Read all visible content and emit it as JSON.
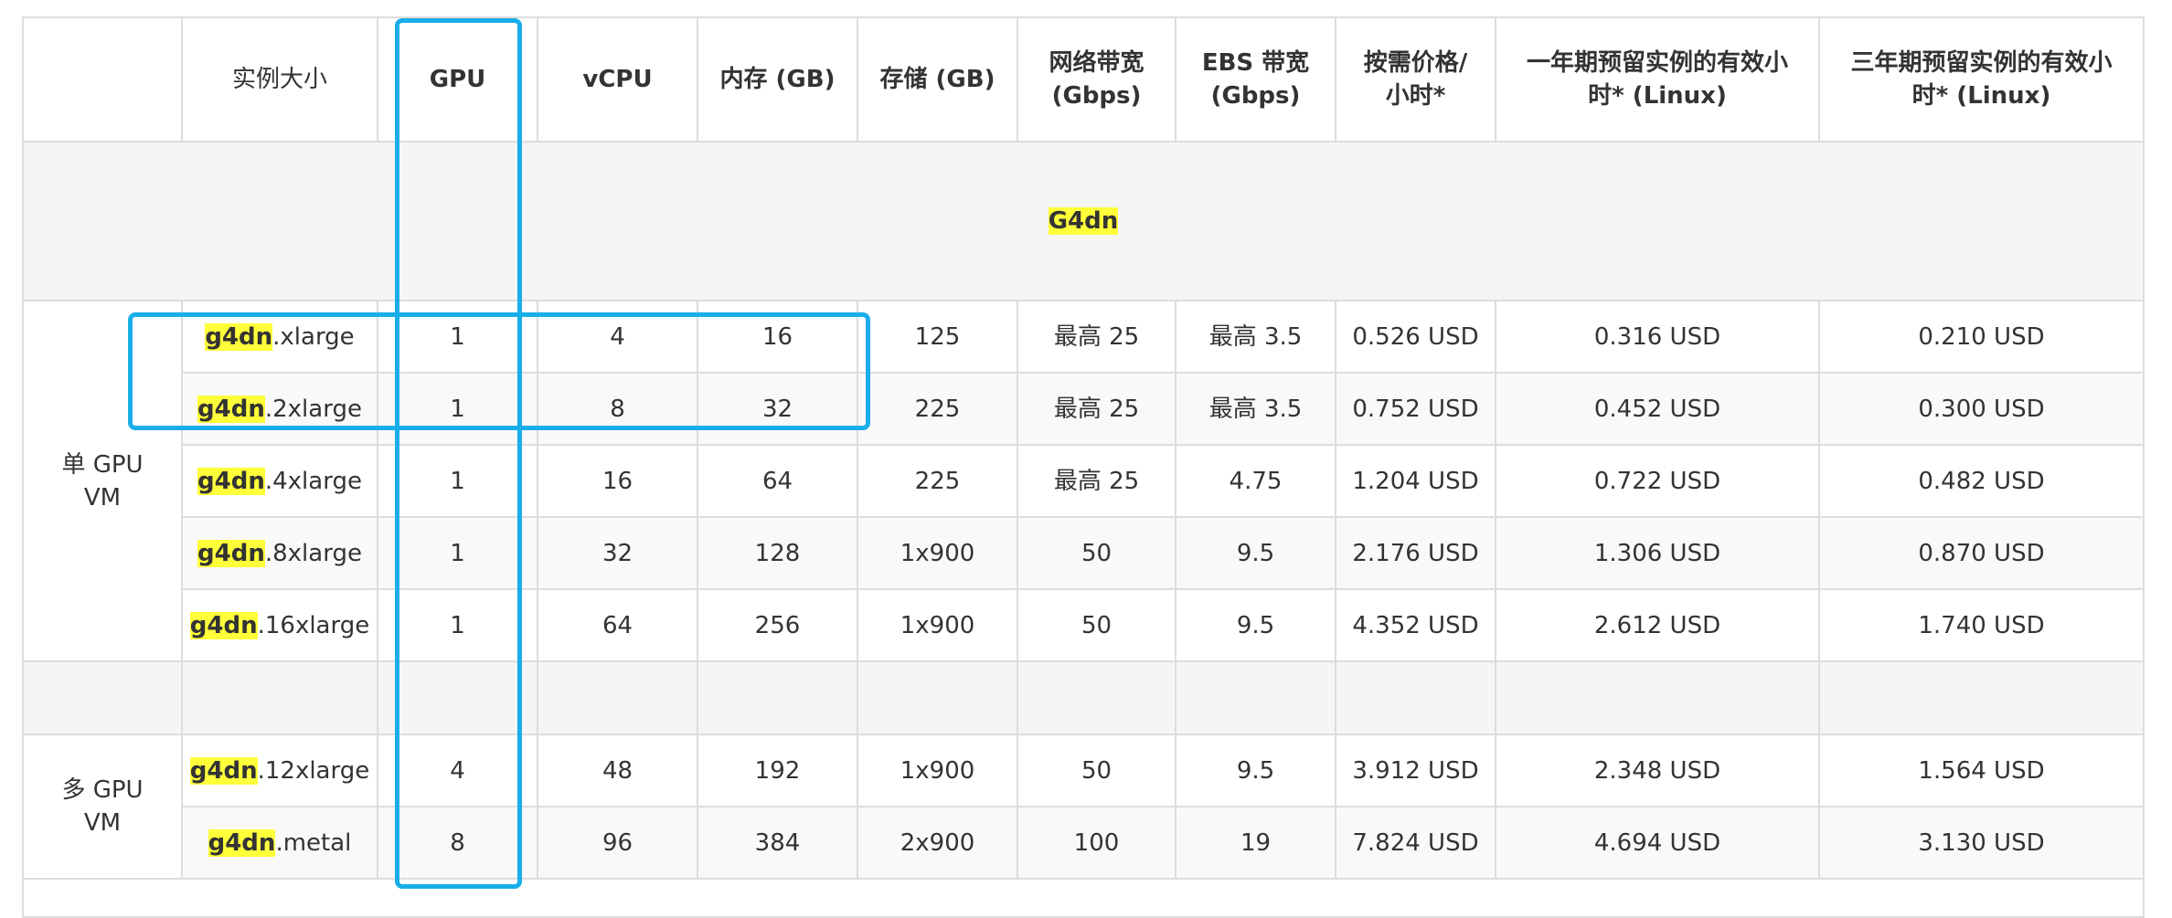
{
  "headers": {
    "group": "",
    "size": "实例大小",
    "gpu": "GPU",
    "vcpu": "vCPU",
    "memory": "内存 (GB)",
    "storage": "存储 (GB)",
    "network_l1": "网络带宽",
    "network_l2": "(Gbps)",
    "ebs_l1": "EBS 带宽",
    "ebs_l2": "(Gbps)",
    "ondemand_l1": "按需价格/",
    "ondemand_l2": "小时*",
    "ri1_l1": "一年期预留实例的有效小",
    "ri1_l2": "时* (Linux)",
    "ri3_l1": "三年期预留实例的有效小",
    "ri3_l2": "时* (Linux)"
  },
  "family_title": "G4dn",
  "groups": {
    "single_l1": "单 GPU",
    "single_l2": "VM",
    "multi_l1": "多 GPU",
    "multi_l2": "VM"
  },
  "rows": [
    {
      "prefix": "g4dn",
      "suffix": ".xlarge",
      "gpu": "1",
      "vcpu": "4",
      "memory": "16",
      "storage": "125",
      "network": "最高 25",
      "ebs": "最高 3.5",
      "ondemand": "0.526 USD",
      "ri1": "0.316 USD",
      "ri3": "0.210 USD"
    },
    {
      "prefix": "g4dn",
      "suffix": ".2xlarge",
      "gpu": "1",
      "vcpu": "8",
      "memory": "32",
      "storage": "225",
      "network": "最高 25",
      "ebs": "最高 3.5",
      "ondemand": "0.752 USD",
      "ri1": "0.452 USD",
      "ri3": "0.300 USD"
    },
    {
      "prefix": "g4dn",
      "suffix": ".4xlarge",
      "gpu": "1",
      "vcpu": "16",
      "memory": "64",
      "storage": "225",
      "network": "最高 25",
      "ebs": "4.75",
      "ondemand": "1.204 USD",
      "ri1": "0.722 USD",
      "ri3": "0.482 USD"
    },
    {
      "prefix": "g4dn",
      "suffix": ".8xlarge",
      "gpu": "1",
      "vcpu": "32",
      "memory": "128",
      "storage": "1x900",
      "network": "50",
      "ebs": "9.5",
      "ondemand": "2.176 USD",
      "ri1": "1.306 USD",
      "ri3": "0.870 USD"
    },
    {
      "prefix": "g4dn",
      "suffix": ".16xlarge",
      "gpu": "1",
      "vcpu": "64",
      "memory": "256",
      "storage": "1x900",
      "network": "50",
      "ebs": "9.5",
      "ondemand": "4.352 USD",
      "ri1": "2.612 USD",
      "ri3": "1.740 USD"
    },
    {
      "prefix": "g4dn",
      "suffix": ".12xlarge",
      "gpu": "4",
      "vcpu": "48",
      "memory": "192",
      "storage": "1x900",
      "network": "50",
      "ebs": "9.5",
      "ondemand": "3.912 USD",
      "ri1": "2.348 USD",
      "ri3": "1.564 USD"
    },
    {
      "prefix": "g4dn",
      "suffix": ".metal",
      "gpu": "8",
      "vcpu": "96",
      "memory": "384",
      "storage": "2x900",
      "network": "100",
      "ebs": "19",
      "ondemand": "7.824 USD",
      "ri1": "4.694 USD",
      "ri3": "3.130 USD"
    }
  ],
  "colors": {
    "highlight": "#ffff3a",
    "annotation_box": "#19aee8",
    "border": "#dddddd",
    "row_alt": "#f9f9f9",
    "section_bg": "#f5f5f5"
  }
}
